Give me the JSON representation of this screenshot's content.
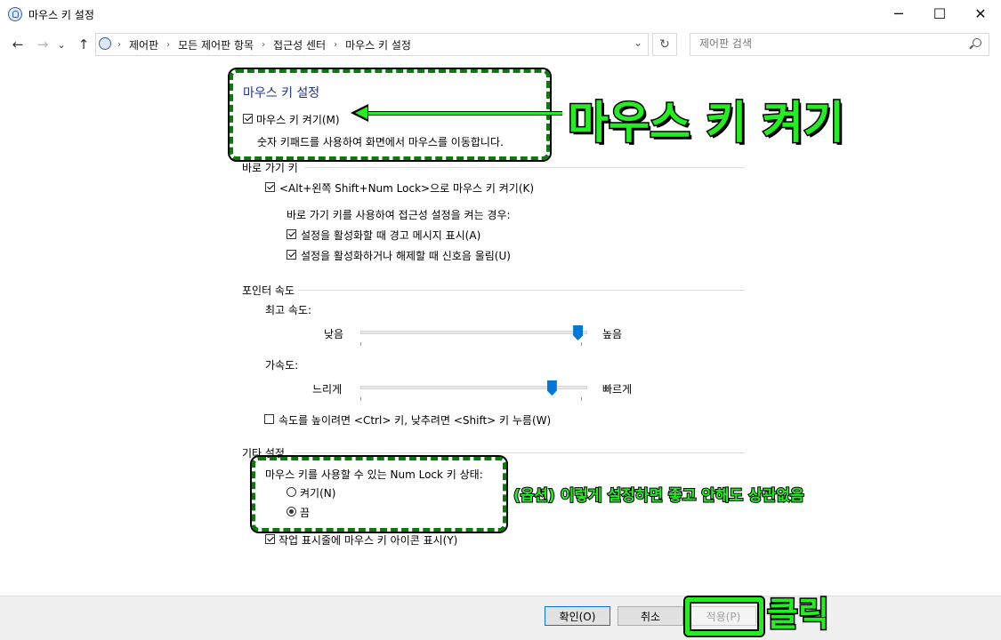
{
  "window": {
    "title": "마우스 키 설정",
    "minimize_icon": "─",
    "maximize_icon": "☐",
    "close_icon": "✕"
  },
  "nav": {
    "back_icon": "←",
    "forward_icon": "→",
    "recent_icon": "⌄",
    "up_icon": "↑",
    "breadcrumb": [
      "제어판",
      "모든 제어판 항목",
      "접근성 센터",
      "마우스 키 설정"
    ],
    "crumb_separator": "›",
    "dropdown_icon": "⌄",
    "refresh_icon": "↻",
    "search_placeholder": "제어판 검색"
  },
  "main": {
    "heading": "마우스 키 설정",
    "enable_mouse_keys": {
      "label": "마우스 키 켜기(M)",
      "checked": true
    },
    "enable_desc": "숫자 키패드를 사용하여 화면에서 마우스를 이동합니다.",
    "shortcut_section": "바로 가기 키",
    "shortcut_checkbox": {
      "label": "<Alt+왼쪽 Shift+Num Lock>으로 마우스 키 켜기(K)",
      "checked": true
    },
    "shortcut_note": "바로 가기 키를 사용하여 접근성 설정을 켜는 경우:",
    "warning_checkbox": {
      "label": "설정을 활성화할 때 경고 메시지 표시(A)",
      "checked": true
    },
    "sound_checkbox": {
      "label": "설정을 활성화하거나 해제할 때 신호음 울림(U)",
      "checked": true
    },
    "pointer_section": "포인터 속도",
    "top_speed": {
      "label": "최고 속도:",
      "low": "낮음",
      "high": "높음",
      "value_fraction": 0.98
    },
    "acceleration": {
      "label": "가속도:",
      "low": "느리게",
      "high": "빠르게",
      "value_fraction": 0.86
    },
    "ctrl_shift_checkbox": {
      "label": "속도를 높이려면 <Ctrl> 키, 낮추려면 <Shift> 키 누름(W)",
      "checked": false
    },
    "other_section": "기타 설정",
    "numlock_label": "마우스 키를 사용할 수 있는 Num Lock 키 상태:",
    "numlock_on": {
      "label": "켜기(N)",
      "selected": false
    },
    "numlock_off": {
      "label": "끔",
      "selected": true
    },
    "taskbar_checkbox": {
      "label": "작업 표시줄에 마우스 키 아이콘 표시(Y)",
      "checked": true
    }
  },
  "footer": {
    "ok": "확인(O)",
    "cancel": "취소",
    "apply": "적용(P)"
  },
  "annotations": {
    "enable_callout": "마우스 키 켜기",
    "option_note": "(옵션) 이렇게 설정하면 좋고 안해도 상관없음",
    "click_note": "클릭",
    "color": "#22ee22"
  }
}
